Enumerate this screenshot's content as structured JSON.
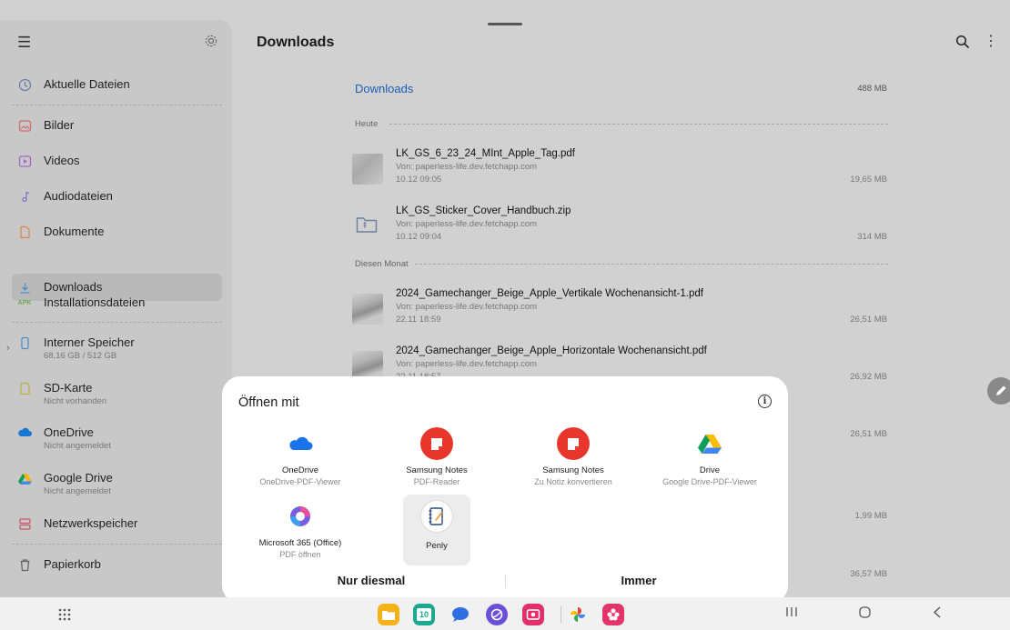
{
  "sidebar": {
    "items": [
      {
        "label": "Aktuelle Dateien"
      },
      {
        "label": "Bilder"
      },
      {
        "label": "Videos"
      },
      {
        "label": "Audiodateien"
      },
      {
        "label": "Dokumente"
      },
      {
        "label": "Downloads"
      },
      {
        "label": "Installationsdateien",
        "badge": "APK"
      },
      {
        "label": "Interner Speicher",
        "sub": "68,16 GB / 512 GB"
      },
      {
        "label": "SD-Karte",
        "sub": "Nicht vorhanden"
      },
      {
        "label": "OneDrive",
        "sub": "Nicht angemeldet"
      },
      {
        "label": "Google Drive",
        "sub": "Nicht angemeldet"
      },
      {
        "label": "Netzwerkspeicher"
      },
      {
        "label": "Papierkorb"
      }
    ]
  },
  "header": {
    "title": "Downloads"
  },
  "breadcrumb": {
    "label": "Downloads",
    "size": "488 MB"
  },
  "groups": {
    "today": "Heute",
    "this_month": "Diesen Monat"
  },
  "files": [
    {
      "name": "LK_GS_6_23_24_MInt_Apple_Tag.pdf",
      "source": "Von: paperless-life.dev.fetchapp.com",
      "date": "10.12 09:05",
      "size": "19,65 MB"
    },
    {
      "name": "LK_GS_Sticker_Cover_Handbuch.zip",
      "source": "Von: paperless-life.dev.fetchapp.com",
      "date": "10.12 09:04",
      "size": "314 MB"
    },
    {
      "name": "2024_Gamechanger_Beige_Apple_Vertikale Wochenansicht-1.pdf",
      "source": "Von: paperless-life.dev.fetchapp.com",
      "date": "22.11 18:59",
      "size": "26,51 MB"
    },
    {
      "name": "2024_Gamechanger_Beige_Apple_Horizontale Wochenansicht.pdf",
      "source": "Von: paperless-life.dev.fetchapp.com",
      "date": "22.11 18:57",
      "size": "26,92 MB"
    }
  ],
  "hidden_sizes": [
    "26,51 MB",
    "1,99 MB",
    "36,57 MB"
  ],
  "dialog": {
    "title": "Öffnen mit",
    "apps": [
      {
        "name": "OneDrive",
        "desc": "OneDrive-PDF-Viewer",
        "icon": "onedrive-icon"
      },
      {
        "name": "Samsung Notes",
        "desc": "PDF-Reader",
        "icon": "samsung-notes-icon"
      },
      {
        "name": "Samsung Notes",
        "desc": "Zu Notiz konvertieren",
        "icon": "samsung-notes-icon"
      },
      {
        "name": "Drive",
        "desc": "Google Drive-PDF-Viewer",
        "icon": "google-drive-icon"
      },
      {
        "name": "Microsoft 365 (Office)",
        "desc": "PDF öffnen",
        "icon": "microsoft-365-icon"
      },
      {
        "name": "Penly",
        "desc": "",
        "icon": "penly-icon"
      }
    ],
    "just_once": "Nur diesmal",
    "always": "Immer"
  },
  "taskbar": {
    "apps": [
      "my-files-icon",
      "calendar-icon",
      "messages-icon",
      "internet-icon",
      "screen-recorder-icon",
      "photos-icon",
      "blossom-app-icon"
    ],
    "calendar_day": "10"
  }
}
